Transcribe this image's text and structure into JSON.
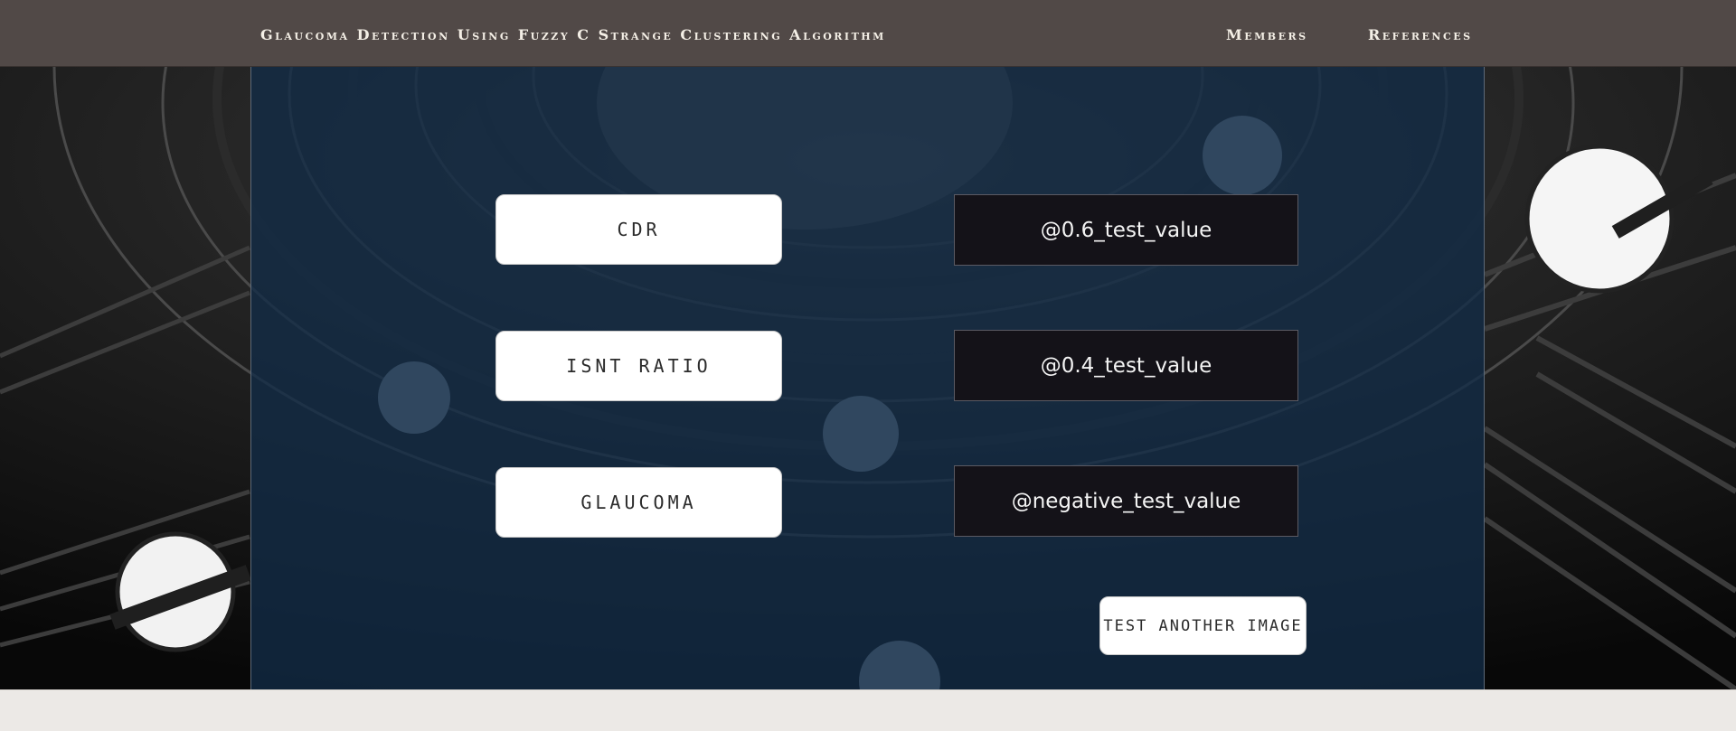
{
  "navbar": {
    "brand": "Glaucoma Detection Using Fuzzy C Strange Clustering Algorithm",
    "links": [
      {
        "label": "Members"
      },
      {
        "label": "References"
      }
    ]
  },
  "results": [
    {
      "label": "CDR",
      "value": "@0.6_test_value"
    },
    {
      "label": "ISNT RATIO",
      "value": "@0.4_test_value"
    },
    {
      "label": "GLAUCOMA",
      "value": "@negative_test_value"
    }
  ],
  "actions": {
    "test_another_label": "TEST ANOTHER IMAGE"
  },
  "colors": {
    "navbar_bg": "#514947",
    "panel_overlay": "#122c47",
    "value_box_bg": "#141218",
    "page_bg": "#ece9e6"
  }
}
